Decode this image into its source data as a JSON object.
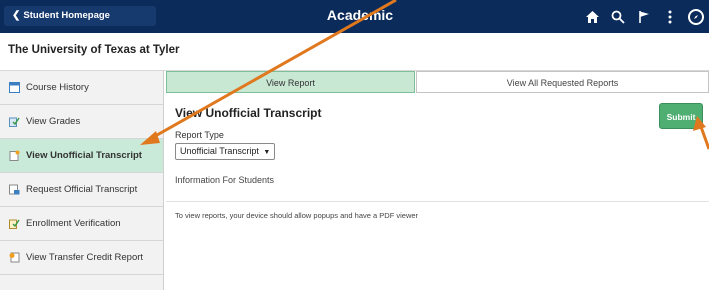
{
  "header": {
    "back_label": "Student Homepage",
    "title": "Academic Records",
    "icons": [
      "home-icon",
      "search-icon",
      "flag-icon",
      "more-icon",
      "navbar-icon"
    ]
  },
  "university": "The University of Texas at Tyler",
  "sidebar": {
    "items": [
      {
        "label": "Course History",
        "icon": "course-history-icon",
        "active": false
      },
      {
        "label": "View Grades",
        "icon": "grades-icon",
        "active": false
      },
      {
        "label": "View Unofficial Transcript",
        "icon": "unofficial-transcript-icon",
        "active": true
      },
      {
        "label": "Request Official Transcript",
        "icon": "official-transcript-icon",
        "active": false
      },
      {
        "label": "Enrollment Verification",
        "icon": "enrollment-icon",
        "active": false
      },
      {
        "label": "View Transfer Credit Report",
        "icon": "transfer-credit-icon",
        "active": false
      }
    ]
  },
  "tabs": [
    {
      "label": "View Report",
      "active": true
    },
    {
      "label": "View All Requested Reports",
      "active": false
    }
  ],
  "main": {
    "title": "View Unofficial Transcript",
    "submit_label": "Submit",
    "report_type_label": "Report Type",
    "report_type_value": "Unofficial Transcript",
    "info_label": "Information For Students",
    "popup_note": "To view reports, your device should allow popups and have a PDF viewer"
  },
  "colors": {
    "header_bg": "#0b2b5b",
    "active_green": "#c9ead8",
    "submit_green": "#4fae72",
    "annotation_arrow": "#e0781e"
  }
}
